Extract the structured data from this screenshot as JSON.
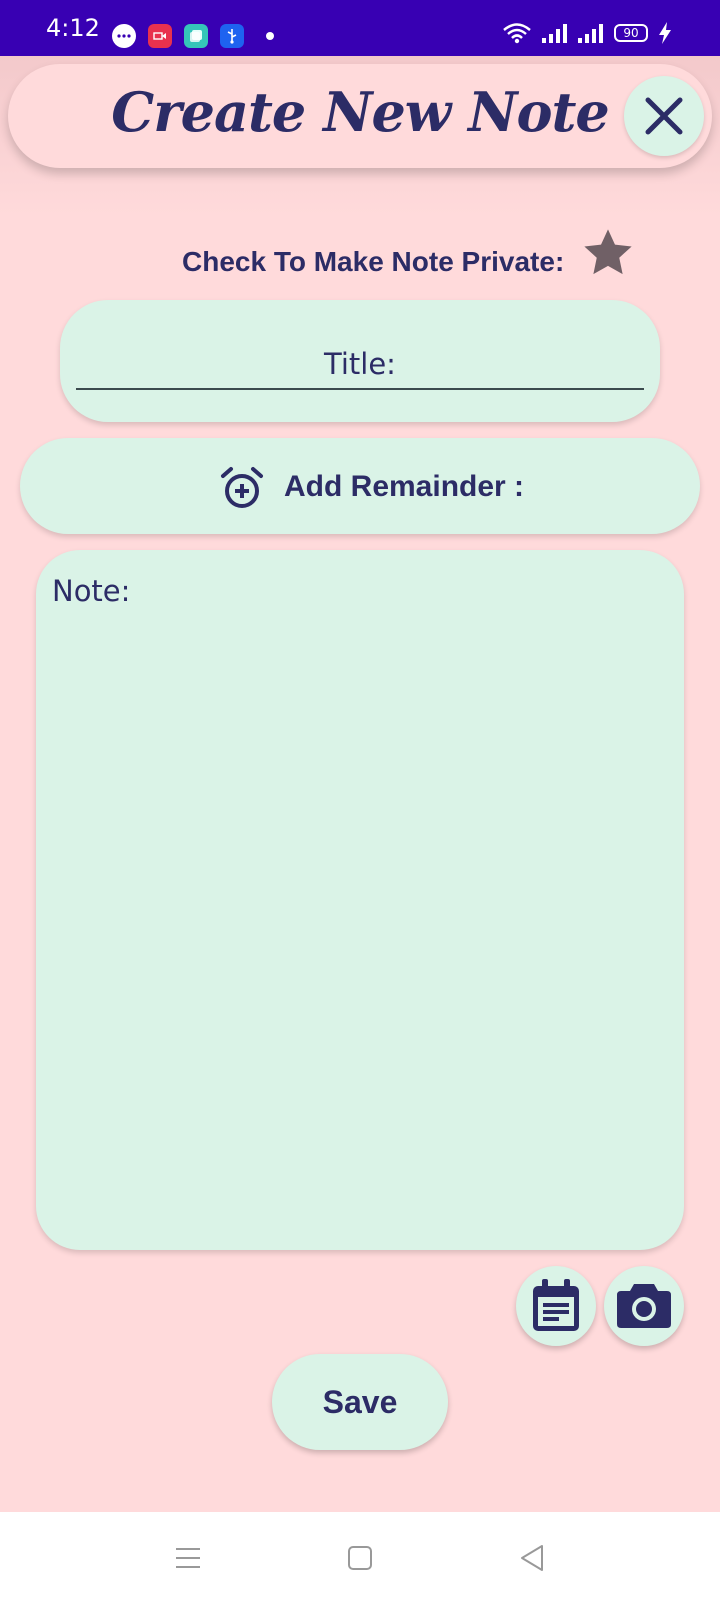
{
  "status_bar": {
    "time": "4:12",
    "battery": "90",
    "notification_icons": [
      "messages-icon",
      "screen-record-icon",
      "gallery-icon",
      "usb-icon",
      "more-dot-icon"
    ],
    "system_icons": [
      "wifi-icon",
      "signal-icon",
      "signal-icon",
      "battery-icon",
      "charging-icon"
    ]
  },
  "header": {
    "title": "Create New Note",
    "close_icon": "close-icon"
  },
  "private_toggle": {
    "label": "Check To Make Note Private:",
    "icon": "star-icon",
    "checked": false
  },
  "title_field": {
    "placeholder": "Title:",
    "value": ""
  },
  "reminder": {
    "icon": "alarm-add-icon",
    "label": "Add Remainder :"
  },
  "note_field": {
    "placeholder": "Note:",
    "value": ""
  },
  "actions": {
    "calendar_icon": "calendar-icon",
    "camera_icon": "camera-icon",
    "save_label": "Save"
  },
  "nav_bar": {
    "buttons": [
      "menu-icon",
      "home-icon",
      "back-icon"
    ]
  },
  "colors": {
    "status_bar": "#3800B3",
    "background": "#FFDADB",
    "card": "#DAF3E7",
    "text": "#2C2C66",
    "star": "#706066"
  }
}
